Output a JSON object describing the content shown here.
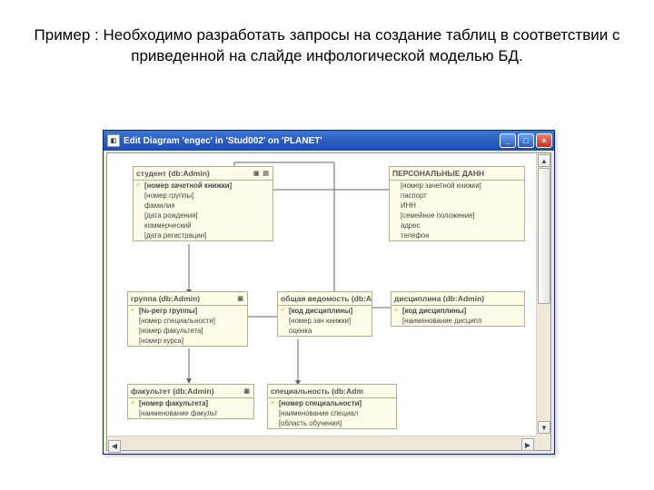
{
  "slide": {
    "title_text": "Пример : Необходимо разработать запросы на создание таблиц в соответствии с приведенной на слайде инфологической моделью БД."
  },
  "window": {
    "title": "Edit Diagram 'engec' in 'Stud002' on 'PLANET'",
    "btn_min": "_",
    "btn_max": "□",
    "btn_close": "×",
    "scroll_up": "▲",
    "scroll_down": "▼",
    "scroll_left": "◀",
    "scroll_right": "▶"
  },
  "entities": {
    "student": {
      "header": "студент (db:Admin)",
      "fields": [
        "[номер зачетной книжки]",
        "[номер группы]",
        "фамилия",
        "[дата рождения]",
        "коммерческий",
        "[дата регистрации]"
      ]
    },
    "personal": {
      "header": "ПЕРСОНАЛЬНЫЕ ДАНН",
      "fields": [
        "[номер зачетной книжки]",
        "паспорт",
        "ИНН",
        "[семейное положение]",
        "адрес",
        "телефон"
      ]
    },
    "group": {
      "header": "группа (db:Admin)",
      "fields": [
        "[№-регр группы]",
        "[номер специальности]",
        "[номер факультета]",
        "[номер курса]"
      ]
    },
    "vedom": {
      "header": "общая ведомость (db:A",
      "fields": [
        "[код дисциплины]",
        "[номер зач книжки]",
        "оценка"
      ]
    },
    "disc": {
      "header": "дисциплина (db:Admin)",
      "fields": [
        "[код дисциплины]",
        "[наименование дисципл"
      ]
    },
    "faculty": {
      "header": "факультет (db:Admin)",
      "fields": [
        "[номер факультета]",
        "[наименование факульт"
      ]
    },
    "spec": {
      "header": "специальность (db:Adm",
      "fields": [
        "[номер специальности]",
        "[наименование специал",
        "[область обучения]"
      ]
    }
  }
}
